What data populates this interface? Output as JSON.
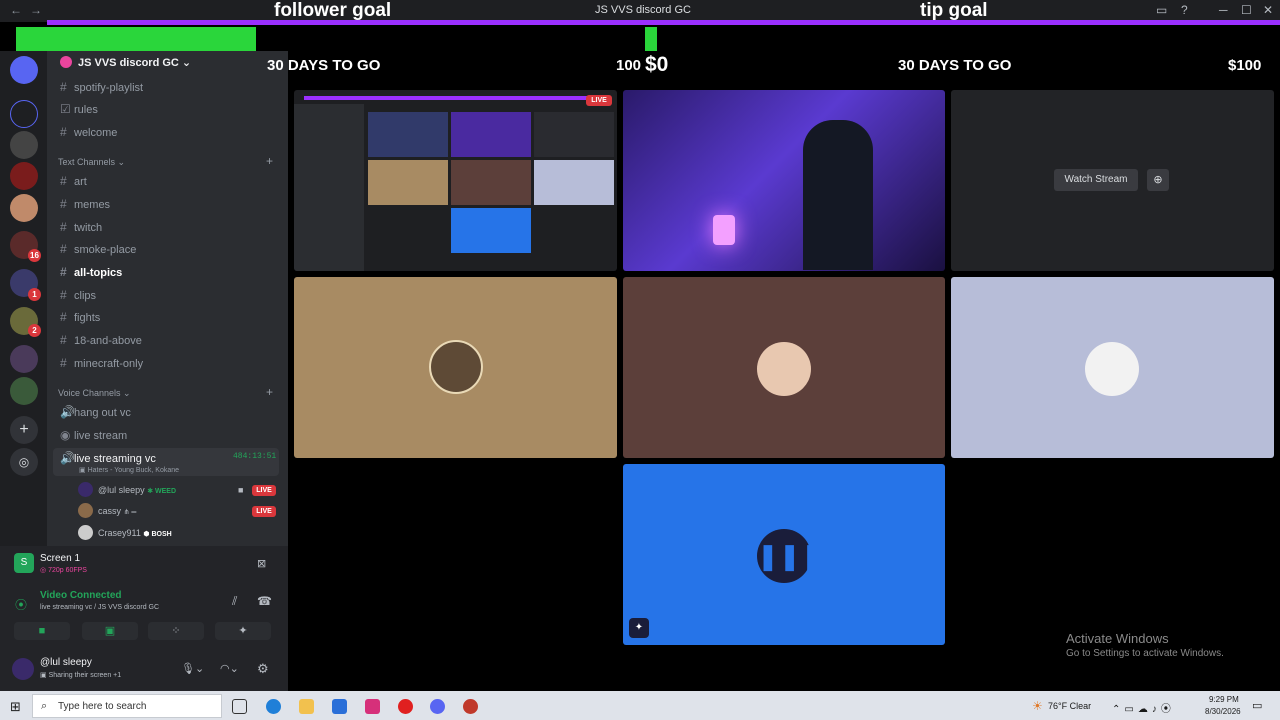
{
  "window": {
    "title": "JS VVS discord GC"
  },
  "overlay": {
    "follower_title": "follower goal",
    "tip_title": "tip goal",
    "left_days": "30 DAYS TO GO",
    "left_goal": "100",
    "left_current": "$0",
    "right_days": "30 DAYS TO GO",
    "right_goal": "$100",
    "follower_progress": 0.19
  },
  "server": {
    "name": "JS VVS discord GC"
  },
  "channels_top": [
    "spotify-playlist",
    "rules",
    "welcome"
  ],
  "text_category": "Text Channels",
  "text_channels": [
    "art",
    "memes",
    "twitch",
    "smoke-place",
    "all-topics",
    "clips",
    "fights",
    "18-and-above",
    "minecraft-only"
  ],
  "active_text_channel": "all-topics",
  "voice_category": "Voice Channels",
  "voice_channels": [
    "hang out vc",
    "live stream"
  ],
  "active_voice": {
    "name": "live streaming vc",
    "timer": "484:13:51",
    "status": "Haters - Young Buck, Kokane"
  },
  "voice_users": [
    {
      "name": "@lul sleepy",
      "tag": "WEED",
      "live": "LIVE"
    },
    {
      "name": "cassy",
      "tag": "",
      "live": "LIVE"
    },
    {
      "name": "Crasey911",
      "tag": "BOSH",
      "live": ""
    }
  ],
  "screen_share": {
    "title": "Screen 1",
    "quality": "720p 60FPS"
  },
  "connection": {
    "status": "Video Connected",
    "detail": "live streaming vc / JS VVS discord GC"
  },
  "user": {
    "name": "@lul sleepy",
    "status": "Sharing their screen +1"
  },
  "stream": {
    "watch_label": "Watch Stream",
    "live_label": "LIVE"
  },
  "activation": {
    "title": "Activate Windows",
    "subtitle": "Go to Settings to activate Windows."
  },
  "taskbar": {
    "search_placeholder": "Type here to search",
    "weather": "76°F  Clear",
    "time": "9:29 PM",
    "date": "8/30/2026"
  },
  "badges": {
    "server1": "16",
    "server2": "1",
    "server3": "2"
  },
  "colors": {
    "accent": "#5865f2",
    "live": "#da373c",
    "green": "#2ad63b",
    "goal_bar": "#9b30ff"
  }
}
